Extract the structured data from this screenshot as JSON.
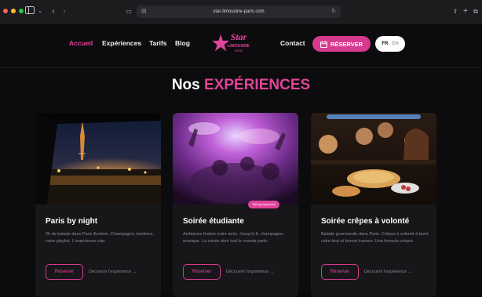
{
  "browser": {
    "url": "star-limousine-paris.com"
  },
  "nav": {
    "links": [
      {
        "label": "Accueil",
        "active": true
      },
      {
        "label": "Expériences"
      },
      {
        "label": "Tarifs"
      },
      {
        "label": "Blog"
      }
    ],
    "contact": "Contact",
    "reserve": "RÉSERVER",
    "lang_fr": "FR",
    "lang_en": "EN"
  },
  "logo": {
    "top": "Star",
    "middle": "LIMOUSINE",
    "bottom": "PARIS"
  },
  "section": {
    "title_plain": "Nos",
    "title_accent": "EXPÉRIENCES"
  },
  "cards": [
    {
      "title": "Paris by night",
      "description": "2h de balade dans Paris illuminé. Champagne, lumières, votre playlist. L'expérience star.",
      "button": "Réserver",
      "link": "Découvrir l'expérience →"
    },
    {
      "title": "Soirée étudiante",
      "badge": "Tarif groupement",
      "description": "Ambiance festive entre amis. Jusqu'à 8, champagne, musique. La soirée dont tout le monde parle.",
      "button": "Réserver",
      "link": "Découvrir l'expérience →"
    },
    {
      "title": "Soirée crêpes à volonté",
      "description": "Balade gourmande dans Paris. Crêpes à volonté à bord, cidre brut et bonne humeur. Une formule unique.",
      "button": "Réserver",
      "link": "Découvrir l'expérience →"
    }
  ],
  "colors": {
    "accent": "#e0449a",
    "background": "#0c0c0e",
    "card": "#17171a"
  }
}
